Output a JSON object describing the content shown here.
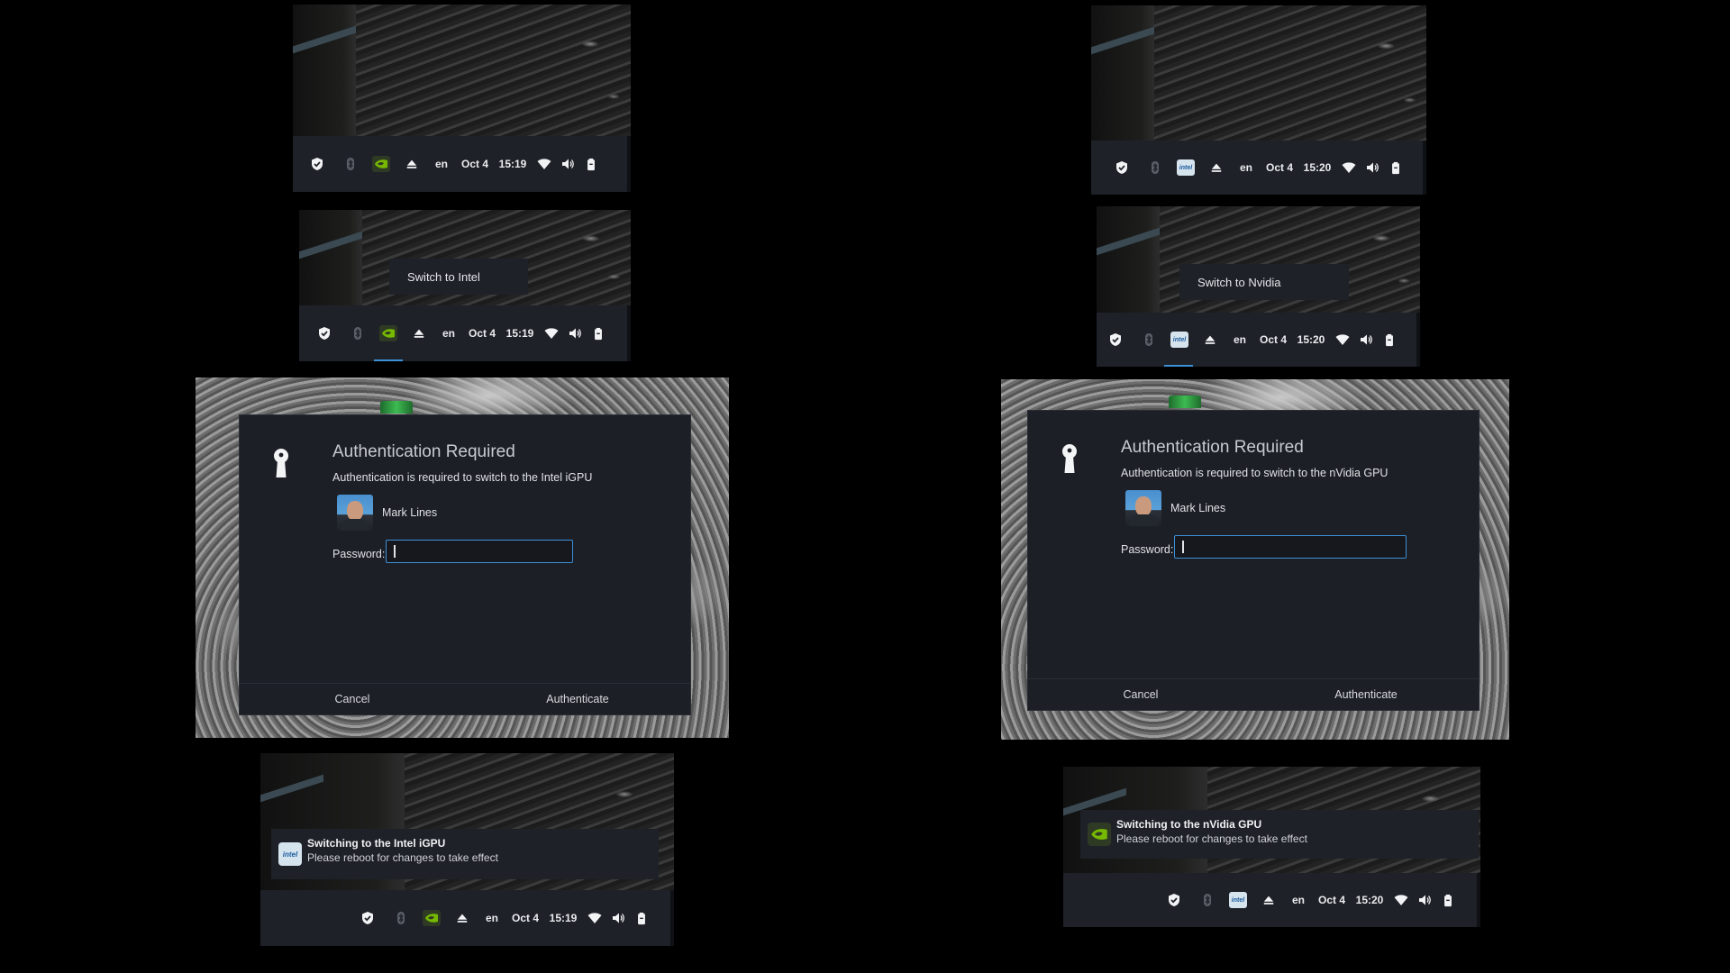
{
  "colors": {
    "accent": "#3d8fd6",
    "panel": "#1e2128",
    "dialog": "#1c1f26"
  },
  "tray_icons": [
    "shield-icon",
    "bluetooth-icon",
    "gpu-indicator-icon",
    "eject-icon",
    "wifi-icon",
    "volume-icon",
    "battery-icon"
  ],
  "left": {
    "tray": {
      "lang": "en",
      "date": "Oct 4",
      "time": "15:19",
      "gpu": "nvidia"
    },
    "tooltip": "Switch to Intel",
    "dialog": {
      "title": "Authentication Required",
      "message": "Authentication is required to switch to the Intel iGPU",
      "user": "Mark Lines",
      "password_label": "Password:",
      "cancel": "Cancel",
      "authenticate": "Authenticate"
    },
    "notification": {
      "title": "Switching to the Intel iGPU",
      "body": "Please reboot for changes to take effect",
      "icon": "intel-icon"
    }
  },
  "right": {
    "tray": {
      "lang": "en",
      "date": "Oct 4",
      "time": "15:20",
      "gpu": "intel"
    },
    "tooltip": "Switch to Nvidia",
    "dialog": {
      "title": "Authentication Required",
      "message": "Authentication is required to switch to the nVidia GPU",
      "user": "Mark Lines",
      "password_label": "Password:",
      "cancel": "Cancel",
      "authenticate": "Authenticate"
    },
    "notification": {
      "title": "Switching to the nVidia GPU",
      "body": "Please reboot for changes to take effect",
      "icon": "nvidia-icon"
    }
  }
}
